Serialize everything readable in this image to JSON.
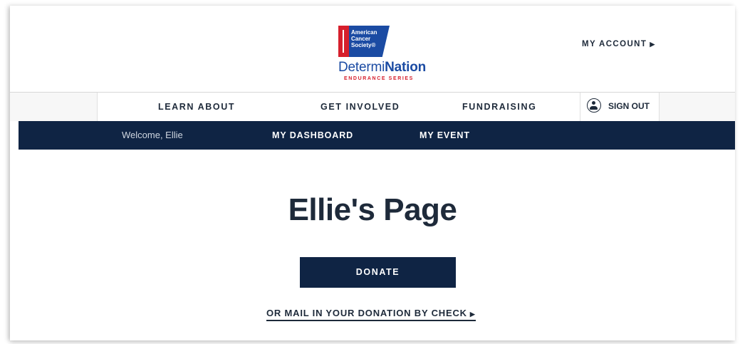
{
  "header": {
    "logo": {
      "acs_lines": [
        "American",
        "Cancer",
        "Society®"
      ],
      "brand_regular": "Determi",
      "brand_bold": "Nation",
      "brand_sub": "ENDURANCE SERIES"
    },
    "my_account": "MY ACCOUNT",
    "my_account_arrow": "▶"
  },
  "nav": {
    "items": [
      "LEARN ABOUT",
      "GET INVOLVED",
      "FUNDRAISING"
    ],
    "sign_out": "SIGN OUT"
  },
  "subnav": {
    "welcome": "Welcome, Ellie",
    "items": [
      "MY DASHBOARD",
      "MY EVENT"
    ]
  },
  "main": {
    "title": "Ellie's Page",
    "donate_label": "DONATE",
    "mail_link": "OR MAIL IN YOUR DONATION BY CHECK",
    "mail_arrow": "▶"
  },
  "colors": {
    "navy": "#0f2444",
    "acs_red": "#d61f2c",
    "acs_blue": "#1b4ba3",
    "text": "#1e2a3a"
  }
}
